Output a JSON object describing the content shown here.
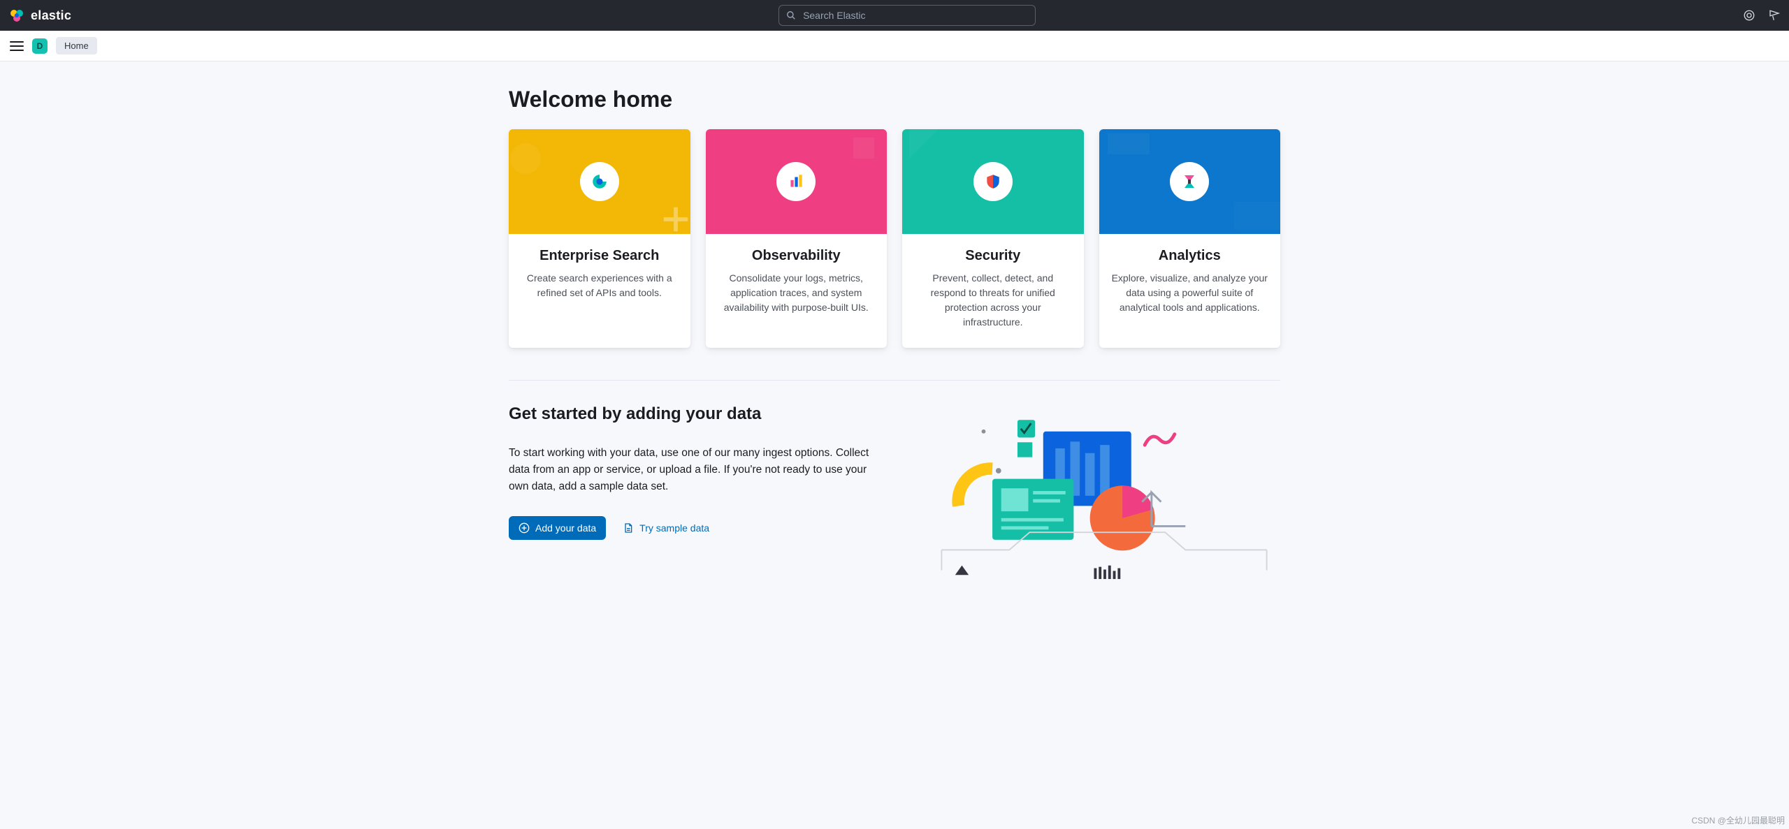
{
  "brand": {
    "name": "elastic"
  },
  "search": {
    "placeholder": "Search Elastic"
  },
  "toolbar": {
    "avatar_initial": "D"
  },
  "breadcrumb": {
    "label": "Home"
  },
  "page": {
    "title": "Welcome home"
  },
  "cards": [
    {
      "title": "Enterprise Search",
      "desc": "Create search experiences with a refined set of APIs and tools.",
      "color": "yellow"
    },
    {
      "title": "Observability",
      "desc": "Consolidate your logs, metrics, application traces, and system availability with purpose-built UIs.",
      "color": "pink"
    },
    {
      "title": "Security",
      "desc": "Prevent, collect, detect, and respond to threats for unified protection across your infrastructure.",
      "color": "teal"
    },
    {
      "title": "Analytics",
      "desc": "Explore, visualize, and analyze your data using a powerful suite of analytical tools and applications.",
      "color": "blue"
    }
  ],
  "get_started": {
    "title": "Get started by adding your data",
    "text": "To start working with your data, use one of our many ingest options. Collect data from an app or service, or upload a file. If you're not ready to use your own data, add a sample data set.",
    "primary_label": "Add your data",
    "secondary_label": "Try sample data"
  },
  "watermark": "CSDN @全幼儿园最聪明"
}
